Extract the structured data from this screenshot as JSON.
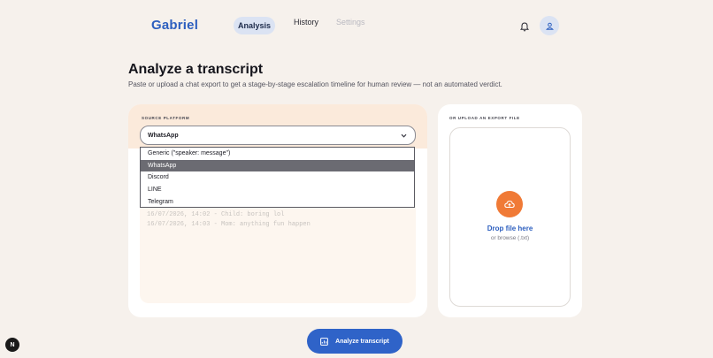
{
  "header": {
    "brand": "Gabriel",
    "tabs": [
      {
        "label": "Analysis",
        "active": true
      },
      {
        "label": "History",
        "active": false
      },
      {
        "label": "Settings",
        "active": false
      }
    ],
    "icons": {
      "notifications": "bell-icon",
      "account": "user-icon"
    }
  },
  "page": {
    "title": "Analyze a transcript",
    "subtitle": "Paste or upload a chat export to get a stage-by-stage escalation timeline for human review — not an automated verdict."
  },
  "source": {
    "label": "SOURCE PLATFORM",
    "selected": "WhatsApp",
    "options": [
      "Generic (\"speaker: message\")",
      "WhatsApp",
      "Discord",
      "LINE",
      "Telegram"
    ]
  },
  "transcript": {
    "lines": [
      "16/07/2026, 14:02 - Child: boring lol",
      "16/07/2026, 14:03 - Mom: anything fun happen"
    ]
  },
  "upload": {
    "label": "OR UPLOAD AN EXPORT FILE",
    "drop_title": "Drop file here",
    "drop_sub": "or browse (.txt)"
  },
  "actions": {
    "analyze_label": "Analyze transcript"
  },
  "badge": {
    "letter": "N"
  },
  "colors": {
    "accent": "#2f63c8",
    "upload_accent": "#f07a36",
    "background": "#f6f1ec",
    "source_panel": "#fbeadb"
  }
}
